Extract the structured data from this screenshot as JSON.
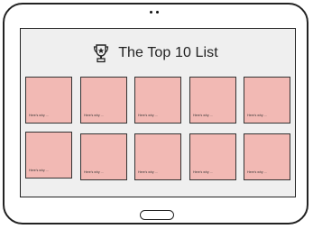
{
  "header": {
    "title": "The Top 10 List",
    "icon": "trophy-icon"
  },
  "cards": [
    {
      "label": "Here's why ..."
    },
    {
      "label": "Here's why ..."
    },
    {
      "label": "Here's why ..."
    },
    {
      "label": "Here's why ..."
    },
    {
      "label": "Here's why ..."
    },
    {
      "label": "Here's why ..."
    },
    {
      "label": "Here's why ..."
    },
    {
      "label": "Here's why ..."
    },
    {
      "label": "Here's why ..."
    },
    {
      "label": "Here's why ..."
    }
  ],
  "colors": {
    "card_fill": "#f2b9b4",
    "screen_bg": "#efefef",
    "outline": "#222222"
  }
}
